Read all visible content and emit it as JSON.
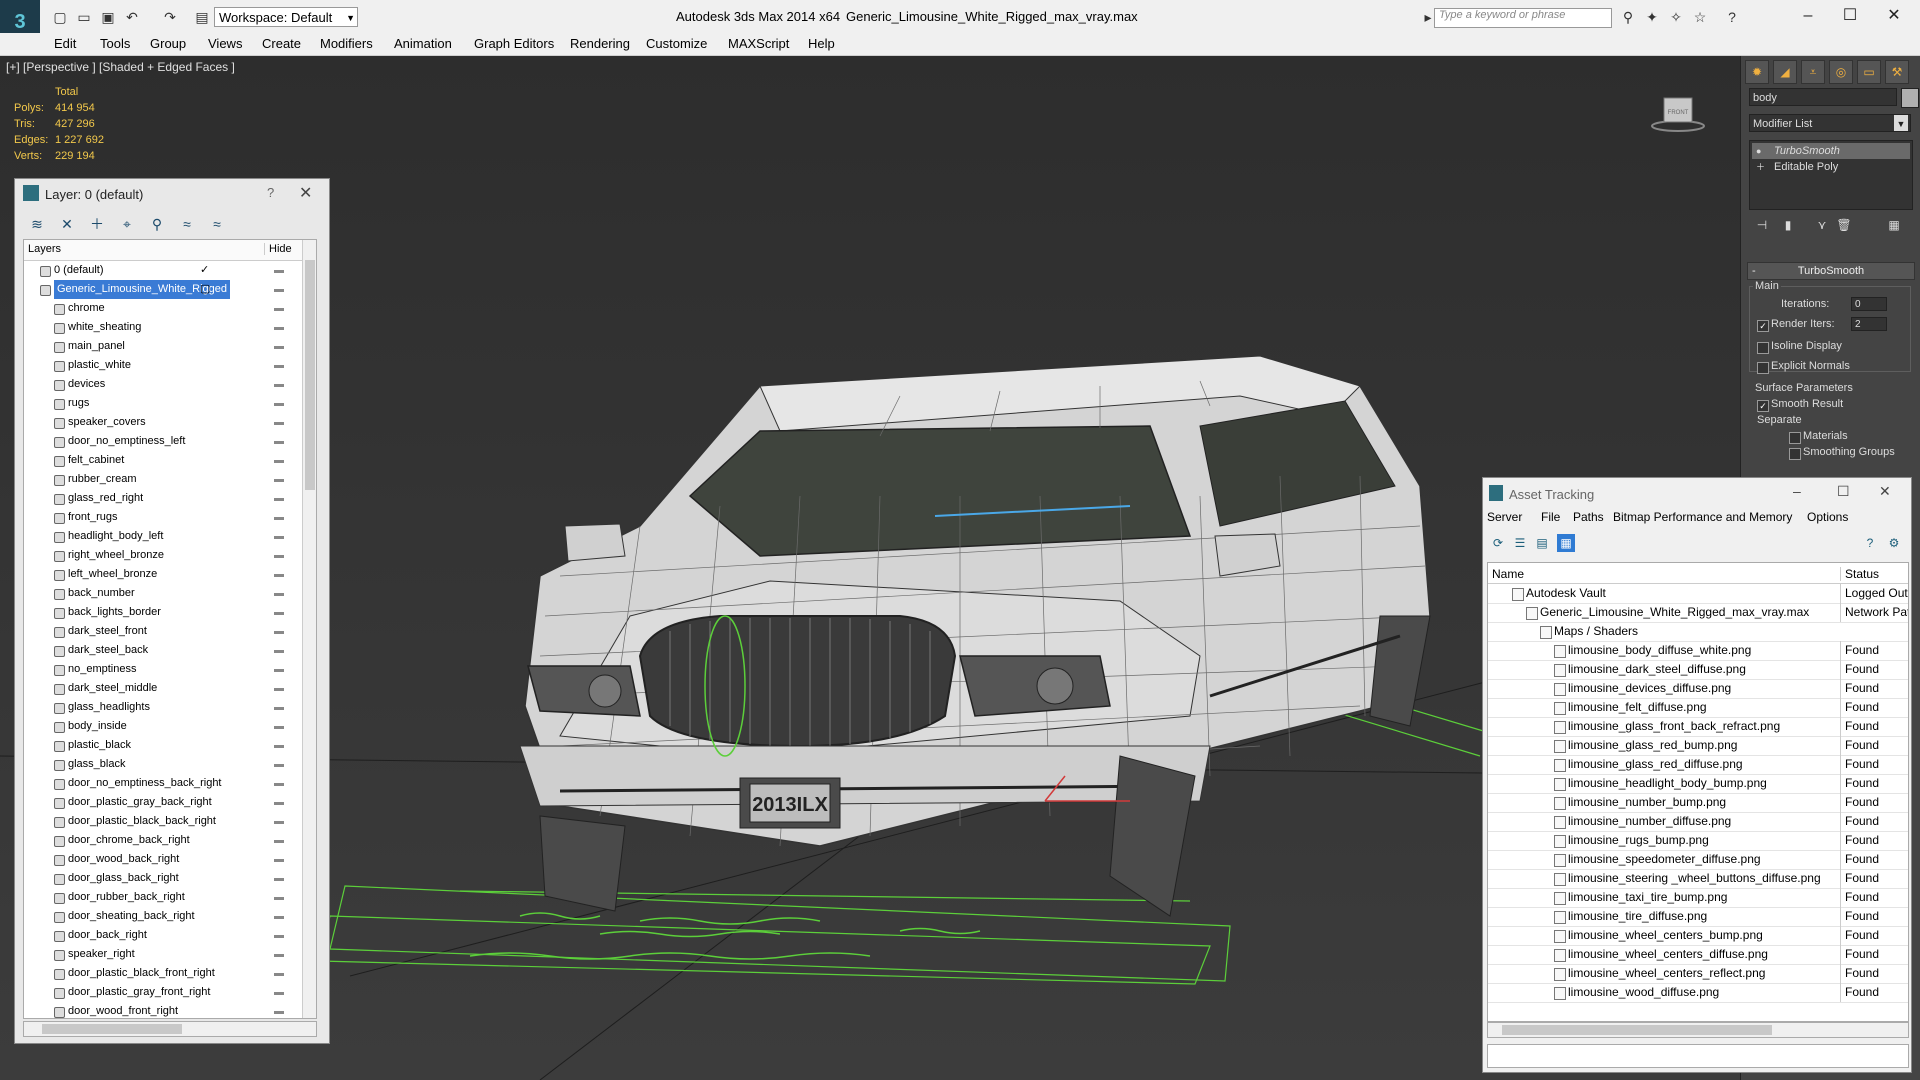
{
  "app": {
    "title": "Autodesk 3ds Max  2014 x64",
    "file_name": "Generic_Limousine_White_Rigged_max_vray.max",
    "workspace": "Workspace: Default",
    "search_placeholder": "Type a keyword or phrase"
  },
  "menu": [
    "Edit",
    "Tools",
    "Group",
    "Views",
    "Create",
    "Modifiers",
    "Animation",
    "Graph Editors",
    "Rendering",
    "Customize",
    "MAXScript",
    "Help"
  ],
  "viewport": {
    "label": "[+] [Perspective ] [Shaded + Edged Faces ]",
    "stats": {
      "header": "Total",
      "rows": [
        {
          "label": "Polys:",
          "value": "414 954"
        },
        {
          "label": "Tris:",
          "value": "427 296"
        },
        {
          "label": "Edges:",
          "value": "1 227 692"
        },
        {
          "label": "Verts:",
          "value": "229 194"
        }
      ]
    },
    "plate_text": "2013ILX",
    "viewcube_label": "FRONT"
  },
  "layer_panel": {
    "title": "Layer: 0 (default)",
    "help": "?",
    "col_layers": "Layers",
    "col_hide": "Hide",
    "rows": [
      {
        "name": "0 (default)",
        "level": 0,
        "check": "✓",
        "selected": false
      },
      {
        "name": "Generic_Limousine_White_Rigged",
        "level": 0,
        "check": "",
        "selected": true
      },
      {
        "name": "chrome",
        "level": 1
      },
      {
        "name": "white_sheating",
        "level": 1
      },
      {
        "name": "main_panel",
        "level": 1
      },
      {
        "name": "plastic_white",
        "level": 1
      },
      {
        "name": "devices",
        "level": 1
      },
      {
        "name": "rugs",
        "level": 1
      },
      {
        "name": "speaker_covers",
        "level": 1
      },
      {
        "name": "door_no_emptiness_left",
        "level": 1
      },
      {
        "name": "felt_cabinet",
        "level": 1
      },
      {
        "name": "rubber_cream",
        "level": 1
      },
      {
        "name": "glass_red_right",
        "level": 1
      },
      {
        "name": "front_rugs",
        "level": 1
      },
      {
        "name": "headlight_body_left",
        "level": 1
      },
      {
        "name": "right_wheel_bronze",
        "level": 1
      },
      {
        "name": "left_wheel_bronze",
        "level": 1
      },
      {
        "name": "back_number",
        "level": 1
      },
      {
        "name": "back_lights_border",
        "level": 1
      },
      {
        "name": "dark_steel_front",
        "level": 1
      },
      {
        "name": "dark_steel_back",
        "level": 1
      },
      {
        "name": "no_emptiness",
        "level": 1
      },
      {
        "name": "dark_steel_middle",
        "level": 1
      },
      {
        "name": "glass_headlights",
        "level": 1
      },
      {
        "name": "body_inside",
        "level": 1
      },
      {
        "name": "plastic_black",
        "level": 1
      },
      {
        "name": "glass_black",
        "level": 1
      },
      {
        "name": "door_no_emptiness_back_right",
        "level": 1
      },
      {
        "name": "door_plastic_gray_back_right",
        "level": 1
      },
      {
        "name": "door_plastic_black_back_right",
        "level": 1
      },
      {
        "name": "door_chrome_back_right",
        "level": 1
      },
      {
        "name": "door_wood_back_right",
        "level": 1
      },
      {
        "name": "door_glass_back_right",
        "level": 1
      },
      {
        "name": "door_rubber_back_right",
        "level": 1
      },
      {
        "name": "door_sheating_back_right",
        "level": 1
      },
      {
        "name": "door_back_right",
        "level": 1
      },
      {
        "name": "speaker_right",
        "level": 1
      },
      {
        "name": "door_plastic_black_front_right",
        "level": 1
      },
      {
        "name": "door_plastic_gray_front_right",
        "level": 1
      },
      {
        "name": "door_wood_front_right",
        "level": 1
      }
    ]
  },
  "command_panel": {
    "object_name": "body",
    "modifier_list": "Modifier List",
    "stack": [
      {
        "name": "TurboSmooth",
        "active": true
      },
      {
        "name": "Editable Poly",
        "active": false
      }
    ],
    "rollout": {
      "title": "TurboSmooth",
      "main_group": "Main",
      "iterations_label": "Iterations:",
      "iterations_value": "0",
      "render_iters_label": "Render Iters:",
      "render_iters_value": "2",
      "isoline": "Isoline Display",
      "explicit_normals": "Explicit Normals",
      "surface_group": "Surface Parameters",
      "smooth_result": "Smooth Result",
      "separate": "Separate",
      "materials": "Materials",
      "smoothing_groups": "Smoothing Groups"
    }
  },
  "asset_tracking": {
    "title": "Asset Tracking",
    "menu": [
      "Server",
      "File",
      "Paths",
      "Bitmap Performance and Memory",
      "Options"
    ],
    "col_name": "Name",
    "col_status": "Status",
    "rows": [
      {
        "name": "Autodesk Vault",
        "level": 1,
        "status": "Logged Out"
      },
      {
        "name": "Generic_Limousine_White_Rigged_max_vray.max",
        "level": 2,
        "status": "Network Pat"
      },
      {
        "name": "Maps / Shaders",
        "level": 3,
        "status": ""
      },
      {
        "name": "limousine_body_diffuse_white.png",
        "level": 4,
        "status": "Found"
      },
      {
        "name": "limousine_dark_steel_diffuse.png",
        "level": 4,
        "status": "Found"
      },
      {
        "name": "limousine_devices_diffuse.png",
        "level": 4,
        "status": "Found"
      },
      {
        "name": "limousine_felt_diffuse.png",
        "level": 4,
        "status": "Found"
      },
      {
        "name": "limousine_glass_front_back_refract.png",
        "level": 4,
        "status": "Found"
      },
      {
        "name": "limousine_glass_red_bump.png",
        "level": 4,
        "status": "Found"
      },
      {
        "name": "limousine_glass_red_diffuse.png",
        "level": 4,
        "status": "Found"
      },
      {
        "name": "limousine_headlight_body_bump.png",
        "level": 4,
        "status": "Found"
      },
      {
        "name": "limousine_number_bump.png",
        "level": 4,
        "status": "Found"
      },
      {
        "name": "limousine_number_diffuse.png",
        "level": 4,
        "status": "Found"
      },
      {
        "name": "limousine_rugs_bump.png",
        "level": 4,
        "status": "Found"
      },
      {
        "name": "limousine_speedometer_diffuse.png",
        "level": 4,
        "status": "Found"
      },
      {
        "name": "limousine_steering _wheel_buttons_diffuse.png",
        "level": 4,
        "status": "Found"
      },
      {
        "name": "limousine_taxi_tire_bump.png",
        "level": 4,
        "status": "Found"
      },
      {
        "name": "limousine_tire_diffuse.png",
        "level": 4,
        "status": "Found"
      },
      {
        "name": "limousine_wheel_centers_bump.png",
        "level": 4,
        "status": "Found"
      },
      {
        "name": "limousine_wheel_centers_diffuse.png",
        "level": 4,
        "status": "Found"
      },
      {
        "name": "limousine_wheel_centers_reflect.png",
        "level": 4,
        "status": "Found"
      },
      {
        "name": "limousine_wood_diffuse.png",
        "level": 4,
        "status": "Found"
      }
    ]
  },
  "colors": {
    "stats_yellow": "#f2c84b",
    "selection_blue": "#3a7bd5",
    "grid_green": "#5ccf3a"
  }
}
